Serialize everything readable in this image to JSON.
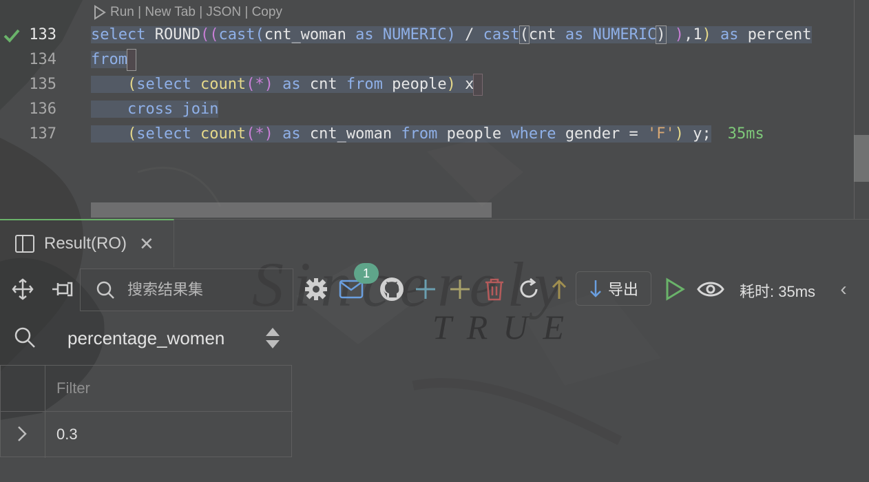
{
  "codelens": "Run | New Tab | JSON | Copy",
  "gutter": {
    "lines": [
      "133",
      "134",
      "135",
      "136",
      "137"
    ]
  },
  "code": {
    "line133": {
      "t1": "select",
      "t2": " ROUND",
      "t3": "((",
      "t4": "cast",
      "t5": "(",
      "t6": "cnt_woman",
      "t7": " as ",
      "t8": "NUMERIC",
      "t9": ")",
      "t10": " / ",
      "t11": "cast",
      "t12": "(",
      "t13": "cnt",
      "t14": " as ",
      "t15": "NUMERIC",
      "t16": ")",
      "t17": " )",
      "t18": ",",
      "t19": "1",
      "t20": ")",
      "t21": " as ",
      "t22": "percent"
    },
    "line134": {
      "t1": "from"
    },
    "line135": {
      "indent": "    ",
      "t1": "(",
      "t2": "select ",
      "t3": "count",
      "t4": "(*)",
      "t5": " as ",
      "t6": "cnt ",
      "t7": "from ",
      "t8": "people",
      "t9": ")",
      "t10": " x"
    },
    "line136": {
      "indent": "    ",
      "t1": "cross join"
    },
    "line137": {
      "indent": "    ",
      "t1": "(",
      "t2": "select ",
      "t3": "count",
      "t4": "(*)",
      "t5": " as ",
      "t6": "cnt_woman ",
      "t7": "from ",
      "t8": "people ",
      "t9": "where ",
      "t10": "gender = ",
      "t11": "'F'",
      "t12": ")",
      "t13": " y;",
      "timing": "35ms"
    }
  },
  "result_tab": {
    "label": "Result(RO)",
    "close": "✕"
  },
  "toolbar": {
    "search_placeholder": "搜索结果集",
    "notification_count": "1",
    "export_label": "导出",
    "elapsed": "耗时: 35ms",
    "collapse": "‹"
  },
  "column": {
    "name": "percentage_women",
    "filter_placeholder": "Filter"
  },
  "rows": [
    {
      "percentage_women": "0.3"
    }
  ],
  "colors": {
    "keyword": "#8fb0e8",
    "function": "#e6d98a",
    "string": "#d8a874",
    "success": "#6ab36a",
    "badge": "#5fa58a",
    "delete": "#b55b5b"
  }
}
